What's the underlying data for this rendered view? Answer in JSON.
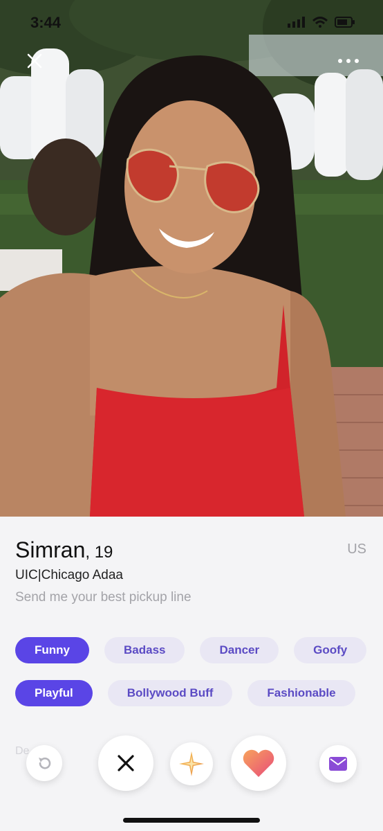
{
  "status_bar": {
    "time": "3:44"
  },
  "profile": {
    "name": "Simran",
    "age": ", 19",
    "country": "US",
    "school": "UIC|Chicago Adaa",
    "bio": "Send me your best pickup line"
  },
  "tags_row1": [
    "Funny",
    "Badass",
    "Dancer",
    "Goofy"
  ],
  "tags_row2": [
    "Playful",
    "Bollywood Buff",
    "Fashionable"
  ],
  "selected_tags": [
    "Funny",
    "Playful"
  ],
  "faded_label": "De",
  "icons": {
    "close": "close-icon",
    "more": "more-icon",
    "rewind": "rewind-icon",
    "pass": "x-icon",
    "super": "sparkle-icon",
    "like": "heart-icon",
    "message": "envelope-icon"
  },
  "colors": {
    "accent": "#5a45e6",
    "tag_bg": "#e9e7f4",
    "tag_text": "#5b4bc4",
    "like_gradient_start": "#f7a35c",
    "like_gradient_end": "#e84b7a",
    "message_icon": "#8a4bd6"
  }
}
